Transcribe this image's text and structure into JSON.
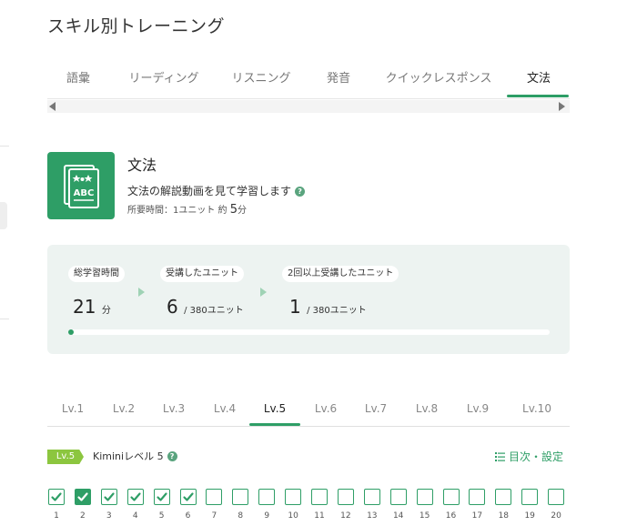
{
  "page": {
    "title": "スキル別トレーニング"
  },
  "tabs": [
    {
      "label": "語彙",
      "active": false
    },
    {
      "label": "リーディング",
      "active": false
    },
    {
      "label": "リスニング",
      "active": false
    },
    {
      "label": "発音",
      "active": false
    },
    {
      "label": "クイックレスポンス",
      "active": false
    },
    {
      "label": "文法",
      "active": true
    }
  ],
  "skill": {
    "icon": "abc-book-icon",
    "title": "文法",
    "description": "文法の解説動画を見て学習します",
    "time_prefix": "所要時間：1ユニット 約",
    "time_value": "5",
    "time_unit": "分",
    "color": "#2e9e66"
  },
  "stats": [
    {
      "label": "総学習時間",
      "value": "21",
      "unit": "分"
    },
    {
      "label": "受講したユニット",
      "value": "6",
      "unit": "/ 380ユニット"
    },
    {
      "label": "2回以上受講したユニット",
      "value": "1",
      "unit": "/ 380ユニット"
    }
  ],
  "progress": {
    "fraction": 0.0
  },
  "levels": [
    {
      "label": "Lv.1",
      "active": false
    },
    {
      "label": "Lv.2",
      "active": false
    },
    {
      "label": "Lv.3",
      "active": false
    },
    {
      "label": "Lv.4",
      "active": false
    },
    {
      "label": "Lv.5",
      "active": true
    },
    {
      "label": "Lv.6",
      "active": false
    },
    {
      "label": "Lv.7",
      "active": false
    },
    {
      "label": "Lv.8",
      "active": false
    },
    {
      "label": "Lv.9",
      "active": false
    },
    {
      "label": "Lv.10",
      "active": false
    }
  ],
  "level_header": {
    "badge": "Lv.5",
    "name": "Kiminiレベル 5",
    "toc_icon": "list-icon",
    "toc_label": "目次・設定",
    "badge_color": "#8cc63f"
  },
  "units": [
    {
      "number": "1",
      "status": "done"
    },
    {
      "number": "2",
      "status": "current"
    },
    {
      "number": "3",
      "status": "done"
    },
    {
      "number": "4",
      "status": "done"
    },
    {
      "number": "5",
      "status": "done"
    },
    {
      "number": "6",
      "status": "done"
    },
    {
      "number": "7",
      "status": "empty"
    },
    {
      "number": "8",
      "status": "empty"
    },
    {
      "number": "9",
      "status": "empty"
    },
    {
      "number": "10",
      "status": "empty"
    },
    {
      "number": "11",
      "status": "empty"
    },
    {
      "number": "12",
      "status": "empty"
    },
    {
      "number": "13",
      "status": "empty"
    },
    {
      "number": "14",
      "status": "empty"
    },
    {
      "number": "15",
      "status": "empty"
    },
    {
      "number": "16",
      "status": "empty"
    },
    {
      "number": "17",
      "status": "empty"
    },
    {
      "number": "18",
      "status": "empty"
    },
    {
      "number": "19",
      "status": "empty"
    },
    {
      "number": "20",
      "status": "empty"
    }
  ]
}
